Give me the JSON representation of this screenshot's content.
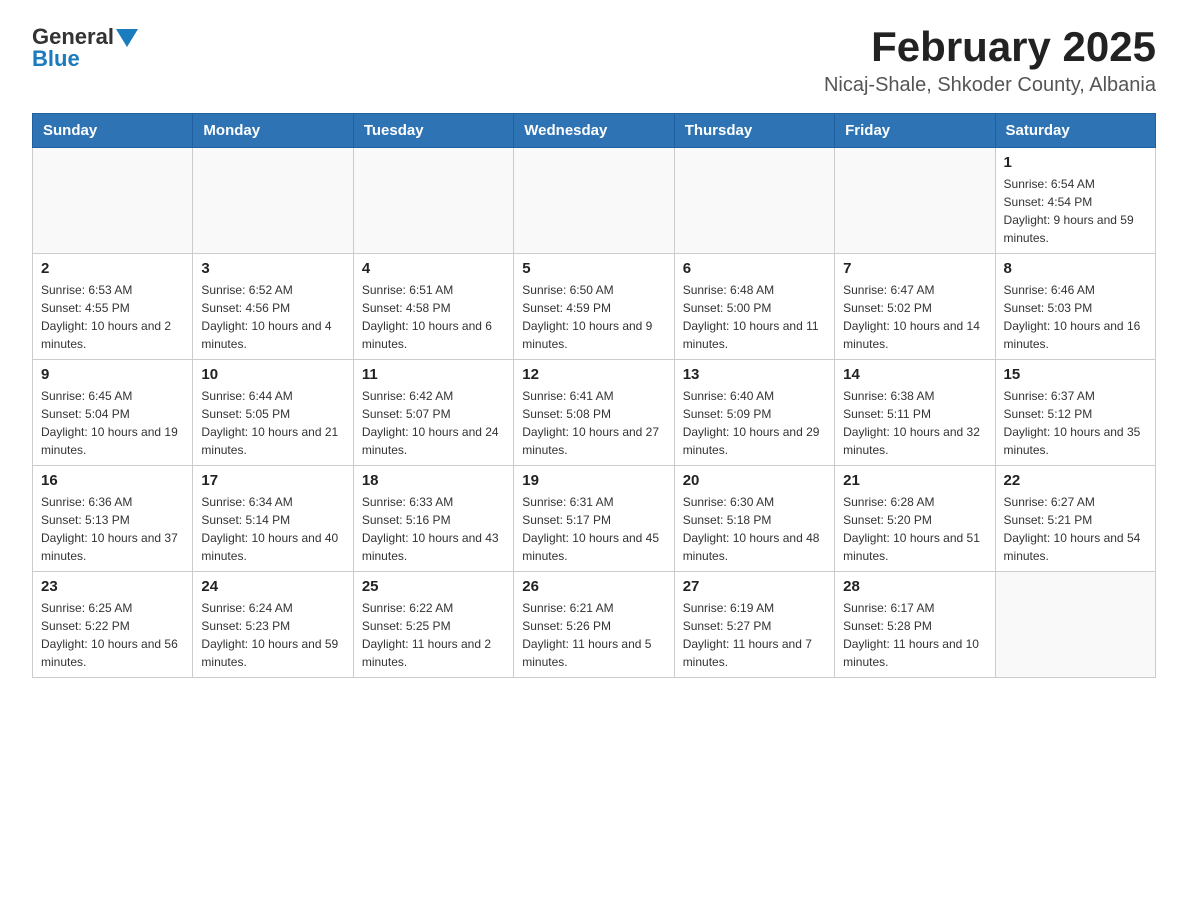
{
  "header": {
    "title": "February 2025",
    "subtitle": "Nicaj-Shale, Shkoder County, Albania",
    "logo": {
      "general": "General",
      "blue": "Blue"
    }
  },
  "weekdays": [
    "Sunday",
    "Monday",
    "Tuesday",
    "Wednesday",
    "Thursday",
    "Friday",
    "Saturday"
  ],
  "weeks": [
    [
      {
        "day": "",
        "info": ""
      },
      {
        "day": "",
        "info": ""
      },
      {
        "day": "",
        "info": ""
      },
      {
        "day": "",
        "info": ""
      },
      {
        "day": "",
        "info": ""
      },
      {
        "day": "",
        "info": ""
      },
      {
        "day": "1",
        "info": "Sunrise: 6:54 AM\nSunset: 4:54 PM\nDaylight: 9 hours and 59 minutes."
      }
    ],
    [
      {
        "day": "2",
        "info": "Sunrise: 6:53 AM\nSunset: 4:55 PM\nDaylight: 10 hours and 2 minutes."
      },
      {
        "day": "3",
        "info": "Sunrise: 6:52 AM\nSunset: 4:56 PM\nDaylight: 10 hours and 4 minutes."
      },
      {
        "day": "4",
        "info": "Sunrise: 6:51 AM\nSunset: 4:58 PM\nDaylight: 10 hours and 6 minutes."
      },
      {
        "day": "5",
        "info": "Sunrise: 6:50 AM\nSunset: 4:59 PM\nDaylight: 10 hours and 9 minutes."
      },
      {
        "day": "6",
        "info": "Sunrise: 6:48 AM\nSunset: 5:00 PM\nDaylight: 10 hours and 11 minutes."
      },
      {
        "day": "7",
        "info": "Sunrise: 6:47 AM\nSunset: 5:02 PM\nDaylight: 10 hours and 14 minutes."
      },
      {
        "day": "8",
        "info": "Sunrise: 6:46 AM\nSunset: 5:03 PM\nDaylight: 10 hours and 16 minutes."
      }
    ],
    [
      {
        "day": "9",
        "info": "Sunrise: 6:45 AM\nSunset: 5:04 PM\nDaylight: 10 hours and 19 minutes."
      },
      {
        "day": "10",
        "info": "Sunrise: 6:44 AM\nSunset: 5:05 PM\nDaylight: 10 hours and 21 minutes."
      },
      {
        "day": "11",
        "info": "Sunrise: 6:42 AM\nSunset: 5:07 PM\nDaylight: 10 hours and 24 minutes."
      },
      {
        "day": "12",
        "info": "Sunrise: 6:41 AM\nSunset: 5:08 PM\nDaylight: 10 hours and 27 minutes."
      },
      {
        "day": "13",
        "info": "Sunrise: 6:40 AM\nSunset: 5:09 PM\nDaylight: 10 hours and 29 minutes."
      },
      {
        "day": "14",
        "info": "Sunrise: 6:38 AM\nSunset: 5:11 PM\nDaylight: 10 hours and 32 minutes."
      },
      {
        "day": "15",
        "info": "Sunrise: 6:37 AM\nSunset: 5:12 PM\nDaylight: 10 hours and 35 minutes."
      }
    ],
    [
      {
        "day": "16",
        "info": "Sunrise: 6:36 AM\nSunset: 5:13 PM\nDaylight: 10 hours and 37 minutes."
      },
      {
        "day": "17",
        "info": "Sunrise: 6:34 AM\nSunset: 5:14 PM\nDaylight: 10 hours and 40 minutes."
      },
      {
        "day": "18",
        "info": "Sunrise: 6:33 AM\nSunset: 5:16 PM\nDaylight: 10 hours and 43 minutes."
      },
      {
        "day": "19",
        "info": "Sunrise: 6:31 AM\nSunset: 5:17 PM\nDaylight: 10 hours and 45 minutes."
      },
      {
        "day": "20",
        "info": "Sunrise: 6:30 AM\nSunset: 5:18 PM\nDaylight: 10 hours and 48 minutes."
      },
      {
        "day": "21",
        "info": "Sunrise: 6:28 AM\nSunset: 5:20 PM\nDaylight: 10 hours and 51 minutes."
      },
      {
        "day": "22",
        "info": "Sunrise: 6:27 AM\nSunset: 5:21 PM\nDaylight: 10 hours and 54 minutes."
      }
    ],
    [
      {
        "day": "23",
        "info": "Sunrise: 6:25 AM\nSunset: 5:22 PM\nDaylight: 10 hours and 56 minutes."
      },
      {
        "day": "24",
        "info": "Sunrise: 6:24 AM\nSunset: 5:23 PM\nDaylight: 10 hours and 59 minutes."
      },
      {
        "day": "25",
        "info": "Sunrise: 6:22 AM\nSunset: 5:25 PM\nDaylight: 11 hours and 2 minutes."
      },
      {
        "day": "26",
        "info": "Sunrise: 6:21 AM\nSunset: 5:26 PM\nDaylight: 11 hours and 5 minutes."
      },
      {
        "day": "27",
        "info": "Sunrise: 6:19 AM\nSunset: 5:27 PM\nDaylight: 11 hours and 7 minutes."
      },
      {
        "day": "28",
        "info": "Sunrise: 6:17 AM\nSunset: 5:28 PM\nDaylight: 11 hours and 10 minutes."
      },
      {
        "day": "",
        "info": ""
      }
    ]
  ]
}
